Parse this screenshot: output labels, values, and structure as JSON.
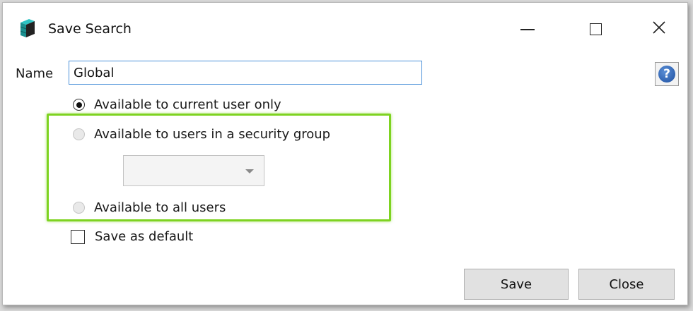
{
  "window": {
    "title": "Save Search",
    "app_icon": "stacked-database-icon",
    "controls": [
      "minimize-icon",
      "maximize-icon",
      "close-icon"
    ],
    "close_glyph": "✕"
  },
  "form": {
    "name_label": "Name",
    "name_value": "Global",
    "help_glyph": "?",
    "options": {
      "current_user": "Available to current user only",
      "security_group": "Available to users in a security group",
      "all_users": "Available to all users"
    },
    "selected_option": "current_user",
    "security_group_value": "",
    "save_default_label": "Save as default",
    "save_default_checked": false
  },
  "buttons": {
    "save": "Save",
    "close": "Close"
  },
  "colors": {
    "highlight": "#7ed321",
    "input_border": "#4a90d9",
    "help_icon": "#1d4fa0",
    "app_icon": "#1aa5a5"
  }
}
